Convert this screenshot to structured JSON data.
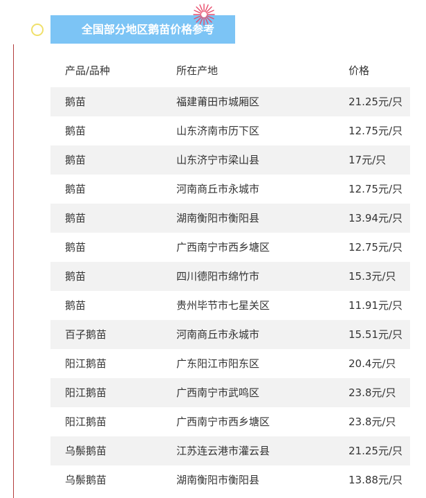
{
  "section": {
    "title": "全国部分地区鹅苗价格参考"
  },
  "table": {
    "headers": [
      "产品/品种",
      "所在产地",
      "价格"
    ],
    "rows": [
      [
        "鹅苗",
        "福建莆田市城厢区",
        "21.25元/只"
      ],
      [
        "鹅苗",
        "山东济南市历下区",
        "12.75元/只"
      ],
      [
        "鹅苗",
        "山东济宁市梁山县",
        "17元/只"
      ],
      [
        "鹅苗",
        "河南商丘市永城市",
        "12.75元/只"
      ],
      [
        "鹅苗",
        "湖南衡阳市衡阳县",
        "13.94元/只"
      ],
      [
        "鹅苗",
        "广西南宁市西乡塘区",
        "12.75元/只"
      ],
      [
        "鹅苗",
        "四川德阳市绵竹市",
        "15.3元/只"
      ],
      [
        "鹅苗",
        "贵州毕节市七星关区",
        "11.91元/只"
      ],
      [
        "百子鹅苗",
        "河南商丘市永城市",
        "15.51元/只"
      ],
      [
        "阳江鹅苗",
        "广东阳江市阳东区",
        "20.4元/只"
      ],
      [
        "阳江鹅苗",
        "广西南宁市武鸣区",
        "23.8元/只"
      ],
      [
        "阳江鹅苗",
        "广西南宁市西乡塘区",
        "23.8元/只"
      ],
      [
        "乌鬃鹅苗",
        "江苏连云港市灌云县",
        "21.25元/只"
      ],
      [
        "乌鬃鹅苗",
        "湖南衡阳市衡阳县",
        "13.88元/只"
      ]
    ]
  },
  "colors": {
    "banner": "#7cc4f5",
    "row_shade": "#f2f2f2",
    "timeline": "#b23a3a",
    "dot": "#f0e06a",
    "burst": "#e84a6a"
  },
  "icons": {
    "timeline_dot": "circle-outline-icon",
    "decoration": "firework-burst-icon"
  }
}
